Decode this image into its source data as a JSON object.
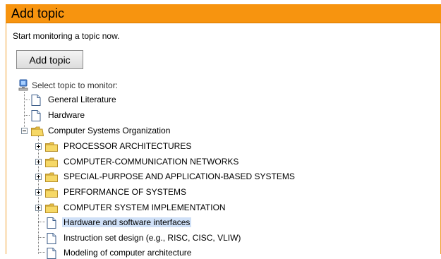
{
  "header": {
    "title": "Add topic"
  },
  "intro": {
    "text": "Start monitoring a topic now."
  },
  "toolbar": {
    "add_label": "Add topic"
  },
  "tree": {
    "root_label": "Select topic to monitor:",
    "items": [
      {
        "label": "General Literature",
        "type": "document",
        "level": 1
      },
      {
        "label": "Hardware",
        "type": "document",
        "level": 1
      },
      {
        "label": "Computer Systems Organization",
        "type": "folder",
        "level": 1,
        "expanded": true
      },
      {
        "label": "PROCESSOR ARCHITECTURES",
        "type": "folder",
        "level": 2,
        "expanded": false
      },
      {
        "label": "COMPUTER-COMMUNICATION NETWORKS",
        "type": "folder",
        "level": 2,
        "expanded": false
      },
      {
        "label": "SPECIAL-PURPOSE AND APPLICATION-BASED SYSTEMS",
        "type": "folder",
        "level": 2,
        "expanded": false
      },
      {
        "label": "PERFORMANCE OF SYSTEMS",
        "type": "folder",
        "level": 2,
        "expanded": false
      },
      {
        "label": "COMPUTER SYSTEM IMPLEMENTATION",
        "type": "folder",
        "level": 2,
        "expanded": false
      },
      {
        "label": "Hardware and software interfaces",
        "type": "document",
        "level": 2,
        "selected": true
      },
      {
        "label": "Instruction set design (e.g., RISC, CISC, VLIW)",
        "type": "document",
        "level": 2
      },
      {
        "label": "Modeling of computer architecture",
        "type": "document",
        "level": 2
      }
    ]
  },
  "colors": {
    "header": "#f7940f",
    "selection": "#cfe0f7",
    "folder": "#f6d866"
  },
  "icons": {
    "root": "computer-icon",
    "document": "document-icon",
    "folder": "folder-icon",
    "expand": "plus-icon",
    "collapse": "minus-icon"
  }
}
